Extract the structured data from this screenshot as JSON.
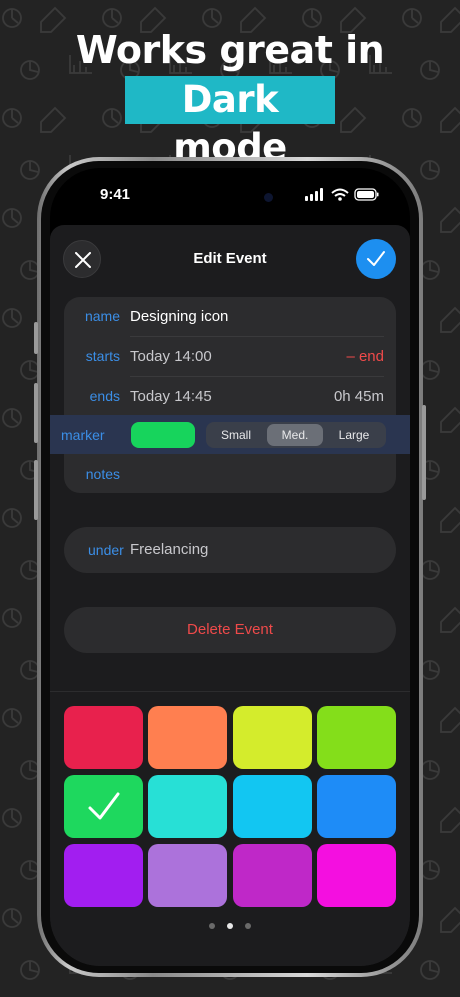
{
  "headline": {
    "line1": "Works great in",
    "line2": "Dark mode"
  },
  "status": {
    "time": "9:41"
  },
  "editor": {
    "title": "Edit Event",
    "name_label": "name",
    "name_value": "Designing icon",
    "starts_label": "starts",
    "starts_value": "Today  14:00",
    "starts_right": "– end",
    "ends_label": "ends",
    "ends_value": "Today  14:45",
    "ends_right": "0h 45m",
    "marker_label": "marker",
    "marker_sizes": [
      "Small",
      "Med.",
      "Large"
    ],
    "marker_selected": "Med.",
    "notes_label": "notes",
    "under_label": "under",
    "under_value": "Freelancing",
    "delete_label": "Delete Event"
  },
  "palette": {
    "colors": [
      "#e8214d",
      "#ff7f50",
      "#d4ec2c",
      "#84de1a",
      "#1ed85e",
      "#27e0d6",
      "#12c6f2",
      "#1e8cf7",
      "#a21ef0",
      "#ac72db",
      "#bf28c8",
      "#f40fe0"
    ],
    "selected_index": 4,
    "pages": 3,
    "current_page": 2
  },
  "colors": {
    "accent": "#1d8ff0",
    "label": "#3b8ee6",
    "danger": "#ef4a4a",
    "highlight": "#1fb8c6"
  }
}
